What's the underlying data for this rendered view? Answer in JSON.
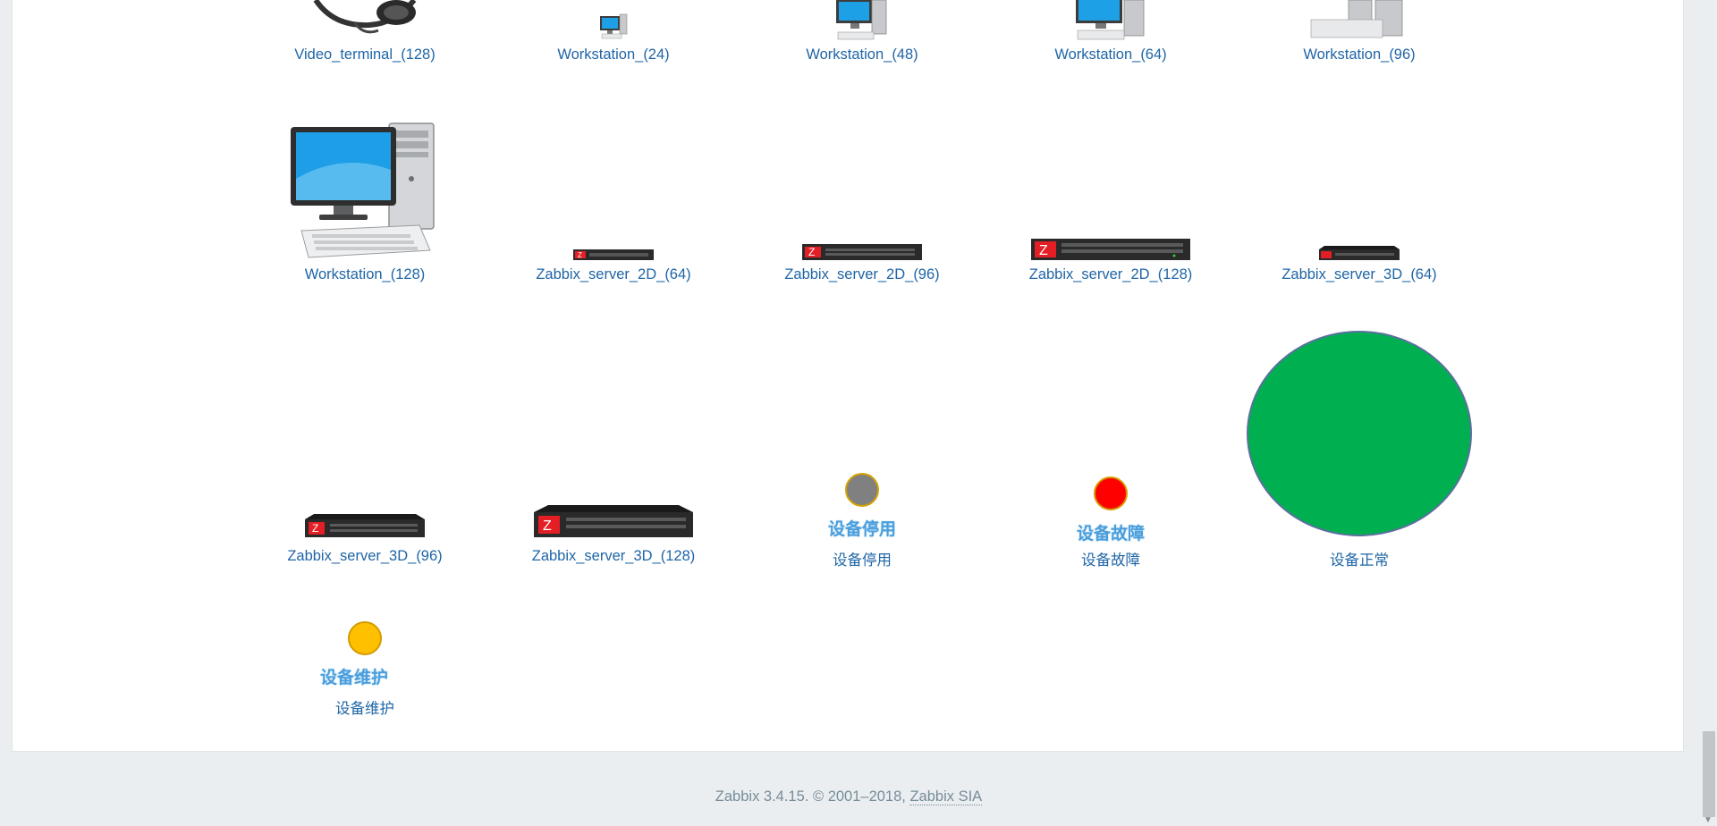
{
  "map_elements": [
    {
      "label": "Video_terminal_(128)",
      "icon": "video-terminal-icon"
    },
    {
      "label": "Workstation_(24)",
      "icon": "workstation-icon"
    },
    {
      "label": "Workstation_(48)",
      "icon": "workstation-icon"
    },
    {
      "label": "Workstation_(64)",
      "icon": "workstation-icon"
    },
    {
      "label": "Workstation_(96)",
      "icon": "workstation-icon"
    },
    {
      "label": "Workstation_(128)",
      "icon": "workstation-icon"
    },
    {
      "label": "Zabbix_server_2D_(64)",
      "icon": "zabbix-server-2d-icon"
    },
    {
      "label": "Zabbix_server_2D_(96)",
      "icon": "zabbix-server-2d-icon"
    },
    {
      "label": "Zabbix_server_2D_(128)",
      "icon": "zabbix-server-2d-icon"
    },
    {
      "label": "Zabbix_server_3D_(64)",
      "icon": "zabbix-server-3d-icon"
    },
    {
      "label": "Zabbix_server_3D_(96)",
      "icon": "zabbix-server-3d-icon"
    },
    {
      "label": "Zabbix_server_3D_(128)",
      "icon": "zabbix-server-3d-icon"
    },
    {
      "label": "设备停用",
      "icon": "status-dot-icon",
      "caption": "设备停用",
      "color": "#808080"
    },
    {
      "label": "设备故障",
      "icon": "status-dot-icon",
      "caption": "设备故障",
      "color": "#ff0000"
    },
    {
      "label": "设备正常",
      "icon": "status-dot-icon",
      "color": "#00b050"
    },
    {
      "label": "设备维护",
      "icon": "status-dot-icon",
      "caption": "设备维护",
      "color": "#ffc000"
    }
  ],
  "footer": {
    "text": "Zabbix 3.4.15. © 2001–2018,",
    "link": "Zabbix SIA"
  },
  "colors": {
    "link": "#1f65a6",
    "background": "#ebeef0",
    "server_red": "#e31e24"
  }
}
